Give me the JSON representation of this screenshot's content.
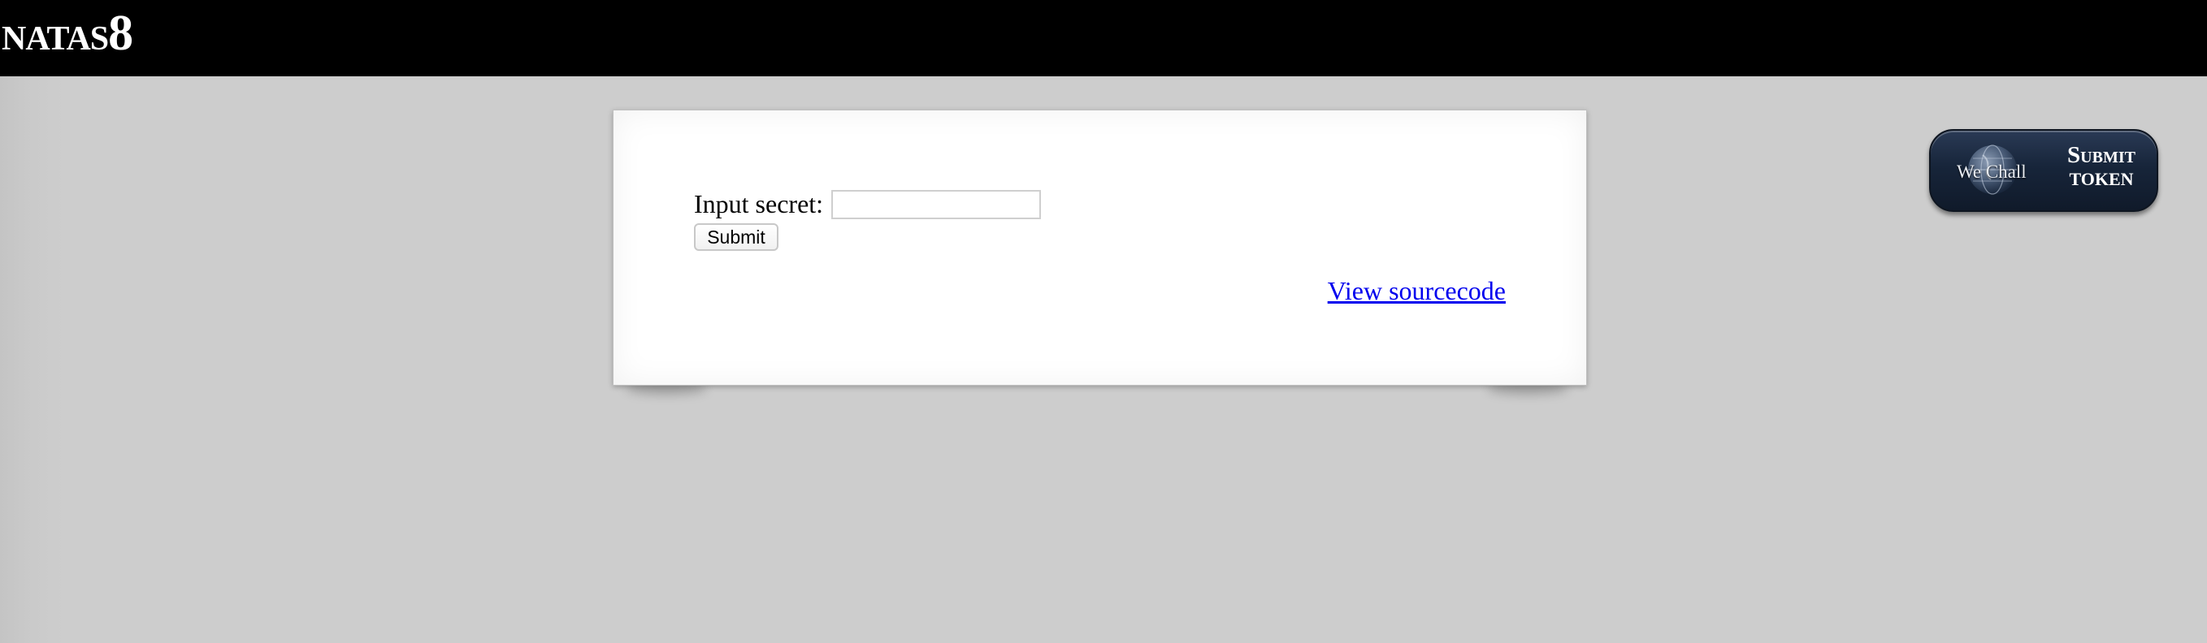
{
  "header": {
    "title_text": "NATAS",
    "title_level": "8"
  },
  "form": {
    "secret_label": "Input secret:",
    "secret_value": "",
    "submit_label": "Submit"
  },
  "links": {
    "view_source": "View sourcecode"
  },
  "wechall": {
    "logo_text": "We Chall",
    "submit_line1": "Submit",
    "submit_line2": "TOKEN",
    "icon": "globe-icon"
  },
  "colors": {
    "header_bg": "#000000",
    "page_bg": "#cccccc",
    "link": "#0000ee",
    "wechall_bg": "#17253a"
  }
}
